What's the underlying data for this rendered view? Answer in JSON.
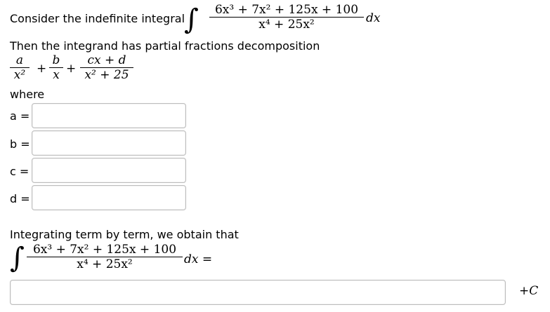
{
  "intro": {
    "prefix": "Consider the indefinite integral",
    "numerator": "6x³ + 7x² + 125x + 100",
    "denominator": "x⁴ + 25x²",
    "dx": "dx"
  },
  "decomposition": {
    "text": "Then the integrand has partial fractions decomposition",
    "term1_num": "a",
    "term1_den": "x²",
    "plus1": "+",
    "term2_num": "b",
    "term2_den": "x",
    "plus2": "+",
    "term3_num": "cx + d",
    "term3_den": "x² + 25",
    "where": "where"
  },
  "fields": [
    {
      "label": "a =",
      "value": ""
    },
    {
      "label": "b =",
      "value": ""
    },
    {
      "label": "c =",
      "value": ""
    },
    {
      "label": "d =",
      "value": ""
    }
  ],
  "integration": {
    "text": "Integrating term by term, we obtain that",
    "numerator": "6x³ + 7x² + 125x + 100",
    "denominator": "x⁴ + 25x²",
    "dx_eq": "dx =",
    "answer_value": "",
    "constant": "+C"
  }
}
